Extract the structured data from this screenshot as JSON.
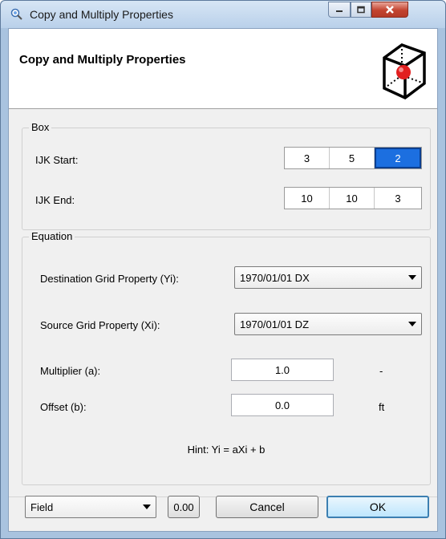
{
  "window": {
    "title": "Copy and Multiply Properties",
    "controls": {
      "minimize": "minimize",
      "maximize": "maximize",
      "close": "close"
    }
  },
  "header": {
    "title": "Copy and Multiply Properties",
    "icon": "grid-cube-icon"
  },
  "box": {
    "legend": "Box",
    "ijk_start_label": "IJK Start:",
    "ijk_start": [
      "3",
      "5",
      "2"
    ],
    "ijk_end_label": "IJK End:",
    "ijk_end": [
      "10",
      "10",
      "3"
    ]
  },
  "equation": {
    "legend": "Equation",
    "destination_label": "Destination Grid Property (Yi):",
    "destination_value": "1970/01/01 DX",
    "source_label": "Source Grid Property (Xi):",
    "source_value": "1970/01/01 DZ",
    "multiplier_label": "Multiplier (a):",
    "multiplier_value": "1.0",
    "multiplier_unit": "-",
    "offset_label": "Offset (b):",
    "offset_value": "0.0",
    "offset_unit": "ft",
    "hint": "Hint: Yi = aXi + b"
  },
  "footer": {
    "field_select": "Field",
    "precision_button": "0.00",
    "cancel_label": "Cancel",
    "ok_label": "OK"
  },
  "colors": {
    "selection": "#1c6fe0",
    "titlebar": "#c4d9ef",
    "close_button": "#c2432f",
    "accent_red": "#e21f1f"
  }
}
